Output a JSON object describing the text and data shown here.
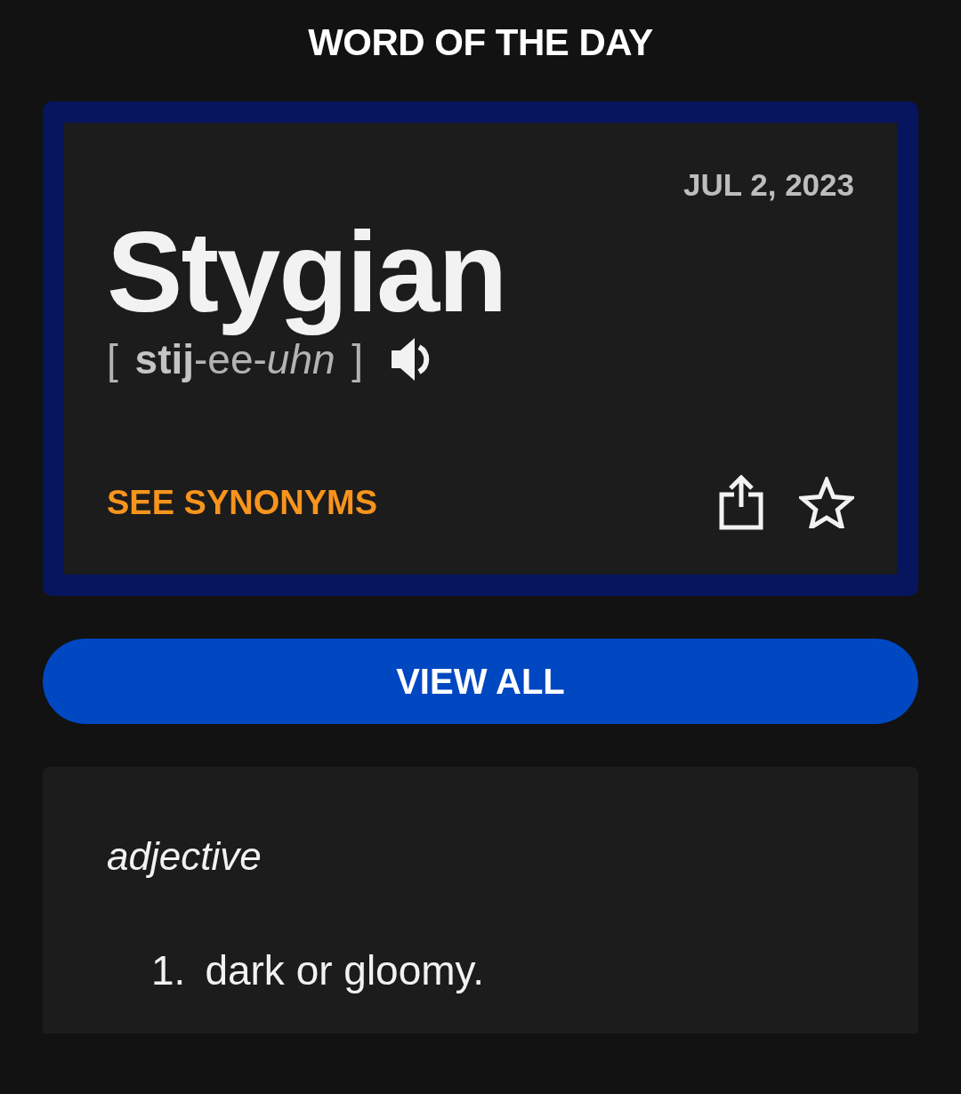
{
  "header": {
    "title": "WORD OF THE DAY"
  },
  "word_card": {
    "date": "JUL 2, 2023",
    "word": "Stygian",
    "pronunciation": "[ **stij**-ee-*uhn* ]",
    "synonyms_link": "SEE SYNONYMS"
  },
  "view_all_button": {
    "label": "VIEW ALL"
  },
  "definition": {
    "part_of_speech": "adjective",
    "senses": [
      {
        "number": "1.",
        "text": "dark or gloomy."
      }
    ]
  }
}
